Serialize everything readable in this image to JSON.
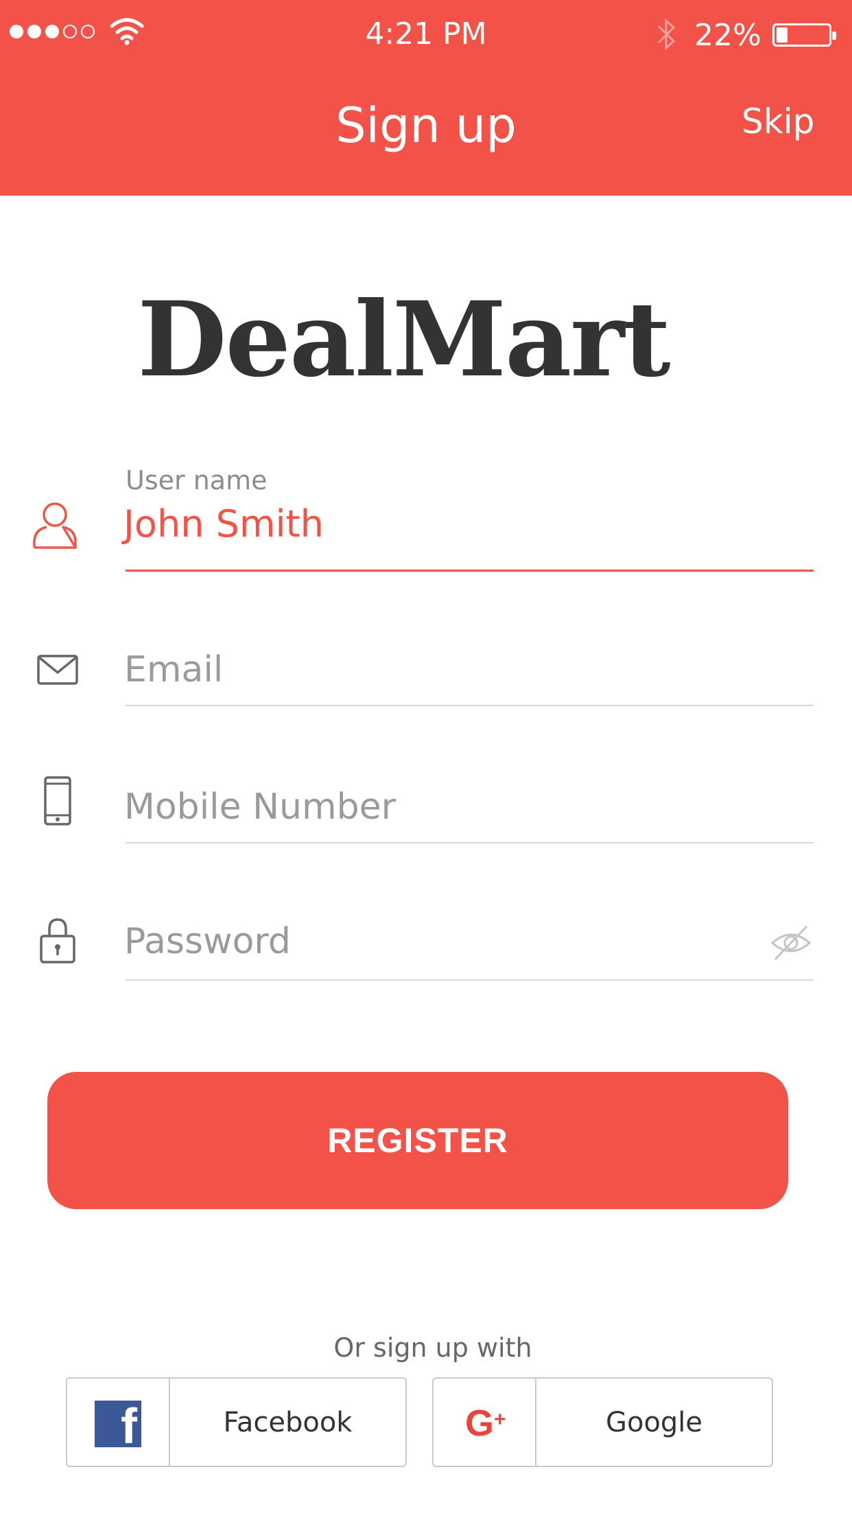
{
  "status_bar": {
    "time": "4:21 PM",
    "battery_percent": "22%",
    "battery_level": 0.22,
    "signal_bars_filled": 3,
    "signal_bars_total": 5
  },
  "header": {
    "title": "Sign up",
    "skip_label": "Skip",
    "background_color": "#f25247"
  },
  "logo": {
    "text": "DealMart"
  },
  "form": {
    "username": {
      "label": "User name",
      "value": "John Smith",
      "icon": "user-icon"
    },
    "email": {
      "placeholder": "Email",
      "icon": "mail-icon"
    },
    "mobile": {
      "placeholder": "Mobile Number",
      "icon": "phone-icon"
    },
    "password": {
      "placeholder": "Password",
      "icon": "lock-icon",
      "toggle_icon": "eye-off-icon"
    }
  },
  "register_label": "REGISTER",
  "social": {
    "prompt": "Or sign up with",
    "facebook": {
      "label": "Facebook",
      "icon": "facebook-icon",
      "color": "#3b5998"
    },
    "google": {
      "label": "Google",
      "icon": "google-plus-icon",
      "color": "#e8453c"
    }
  },
  "accent_color": "#f25247"
}
